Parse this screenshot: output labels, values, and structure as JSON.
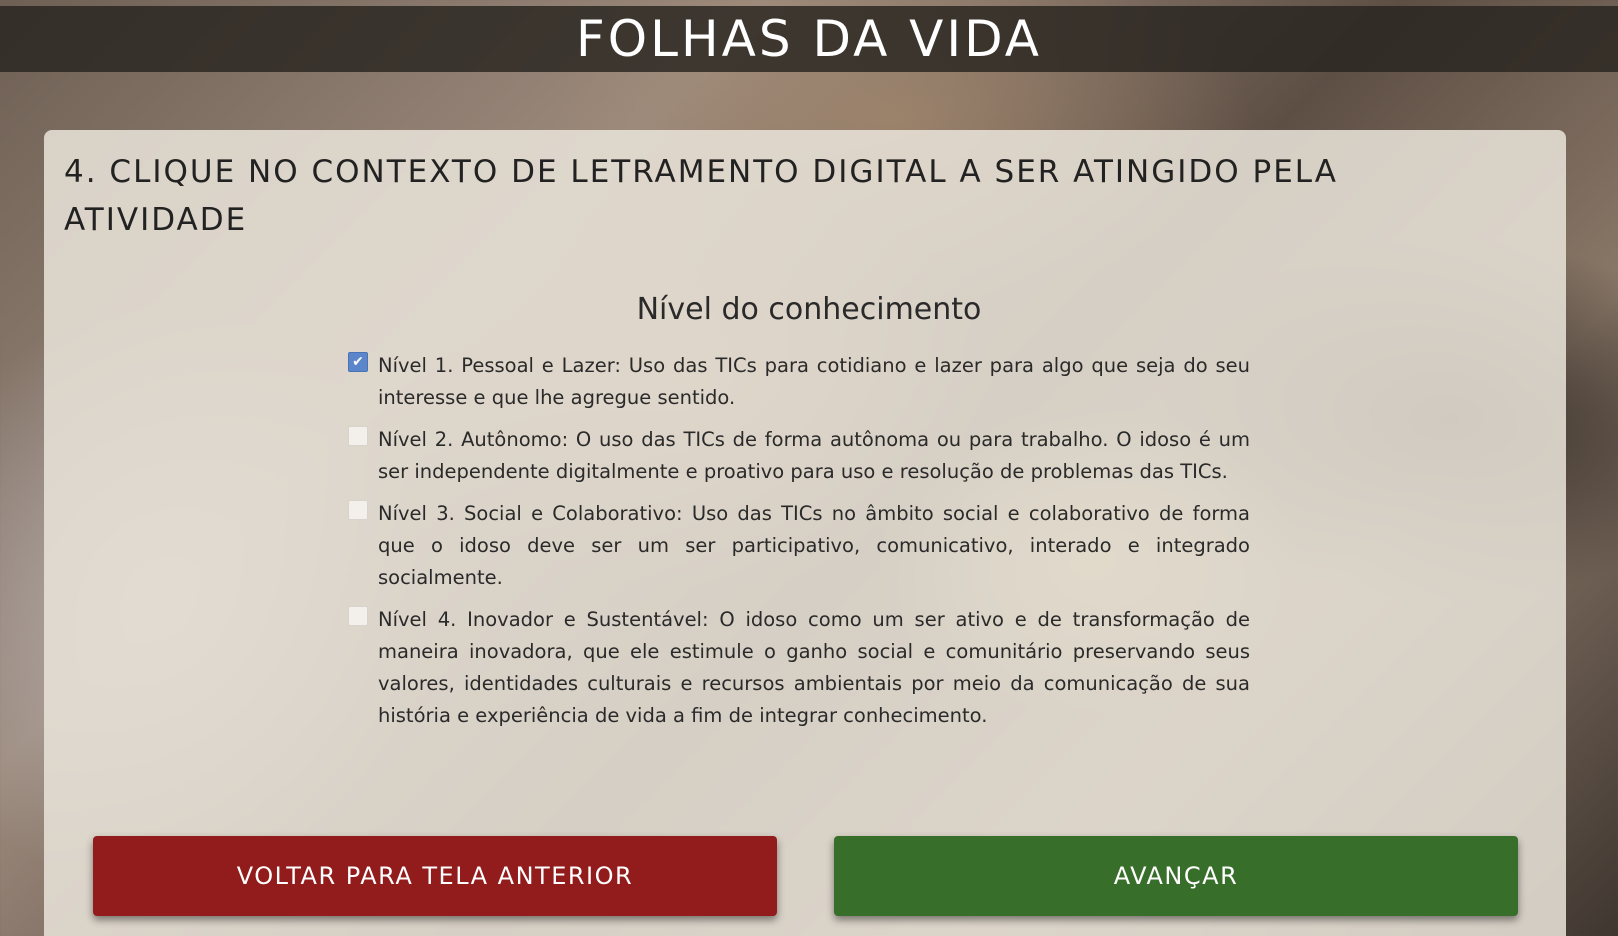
{
  "header": {
    "title": "FOLHAS DA VIDA"
  },
  "question": {
    "text": "4. CLIQUE NO CONTEXTO DE LETRAMENTO DIGITAL A SER ATINGIDO PELA ATIVIDADE"
  },
  "section": {
    "title": "Nível do conhecimento"
  },
  "options": [
    {
      "label": "Nível 1. Pessoal e Lazer: Uso das TICs para cotidiano e lazer para algo que seja do seu interesse e que lhe agregue sentido.",
      "checked": true
    },
    {
      "label": "Nível 2. Autônomo: O uso das TICs de forma autônoma ou para trabalho. O idoso é um ser independente digitalmente e proativo para uso e resolução de problemas das TICs.",
      "checked": false
    },
    {
      "label": "Nível 3. Social e Colaborativo: Uso das TICs no âmbito social e colaborativo de forma que o idoso deve ser um ser participativo, comunicativo, interado e integrado socialmente.",
      "checked": false
    },
    {
      "label": "Nível 4. Inovador e Sustentável: O idoso como um ser ativo e de transformação de maneira inovadora, que ele estimule o ganho social e comunitário preservando seus valores, identidades culturais e recursos ambientais por meio da comunicação de sua história e experiência de vida a fim de integrar conhecimento.",
      "checked": false
    }
  ],
  "buttons": {
    "back_label": "VOLTAR PARA TELA ANTERIOR",
    "next_label": "AVANÇAR"
  },
  "colors": {
    "back_button": "#921c1c",
    "next_button": "#376f2a",
    "checkbox_checked": "#5b86c9"
  }
}
